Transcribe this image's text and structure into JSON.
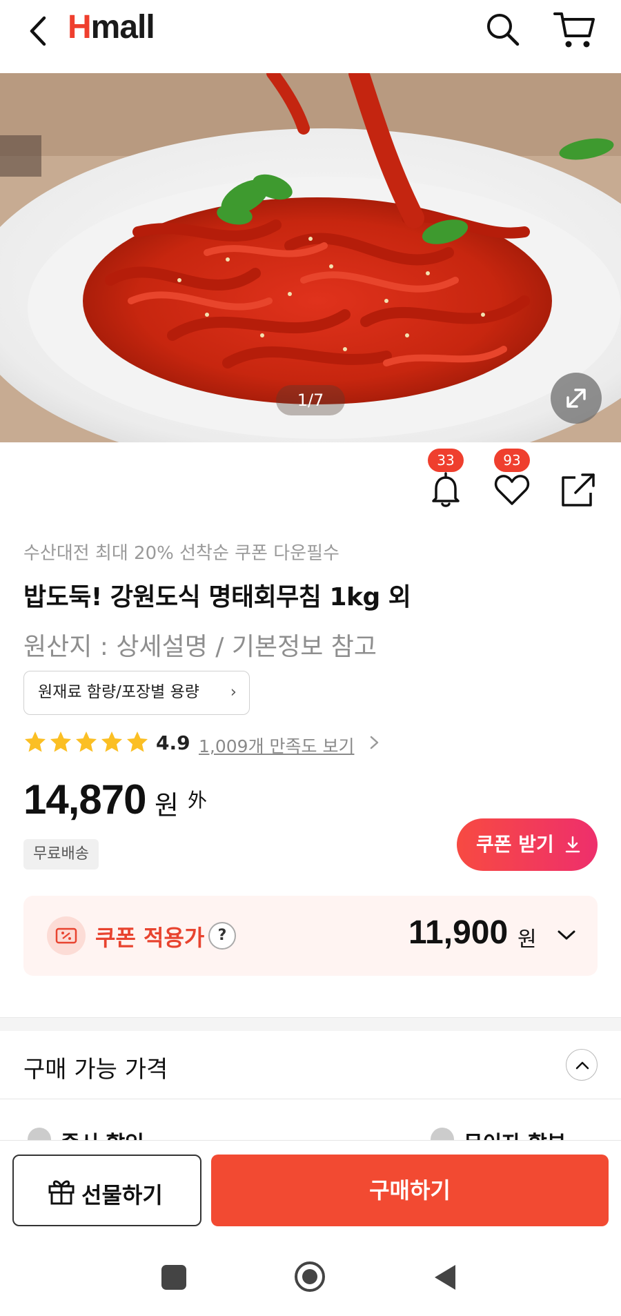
{
  "header": {
    "logo_h": "H",
    "logo_rest": "mall",
    "icons": [
      "back-chevron-icon",
      "search-icon",
      "cart-icon"
    ]
  },
  "gallery": {
    "counter": "1/7",
    "icon": "expand-icon"
  },
  "actions": {
    "alarm_count": "33",
    "like_count": "93",
    "icons": [
      "bell-icon",
      "heart-icon",
      "share-icon"
    ]
  },
  "product": {
    "promo": "수산대전 최대 20% 선착순 쿠폰 다운필수",
    "title": "밥도둑! 강원도식 명태회무침 1kg 외",
    "origin": "원산지 : 상세설명 / 기본정보 참고",
    "info_button": "원재료 함량/포장별 용량",
    "rating": "4.9",
    "stars": 5,
    "review_link": "1,009개 만족도 보기",
    "price": "14,870",
    "price_unit": "원",
    "price_suffix": "外",
    "shipping": "무료배송",
    "coupon_button": "쿠폰 받기"
  },
  "coupon_price": {
    "label": "쿠폰 적용가",
    "help": "?",
    "amount": "11,900",
    "unit": "원"
  },
  "section": {
    "title": "구매 가능 가격",
    "cut_left": "즉시 할인",
    "cut_right": "무이자 할부"
  },
  "bottom": {
    "gift": "선물하기",
    "buy": "구매하기"
  },
  "colors": {
    "accent": "#ef3f2e",
    "coupon_bg": "#fff4f2"
  }
}
